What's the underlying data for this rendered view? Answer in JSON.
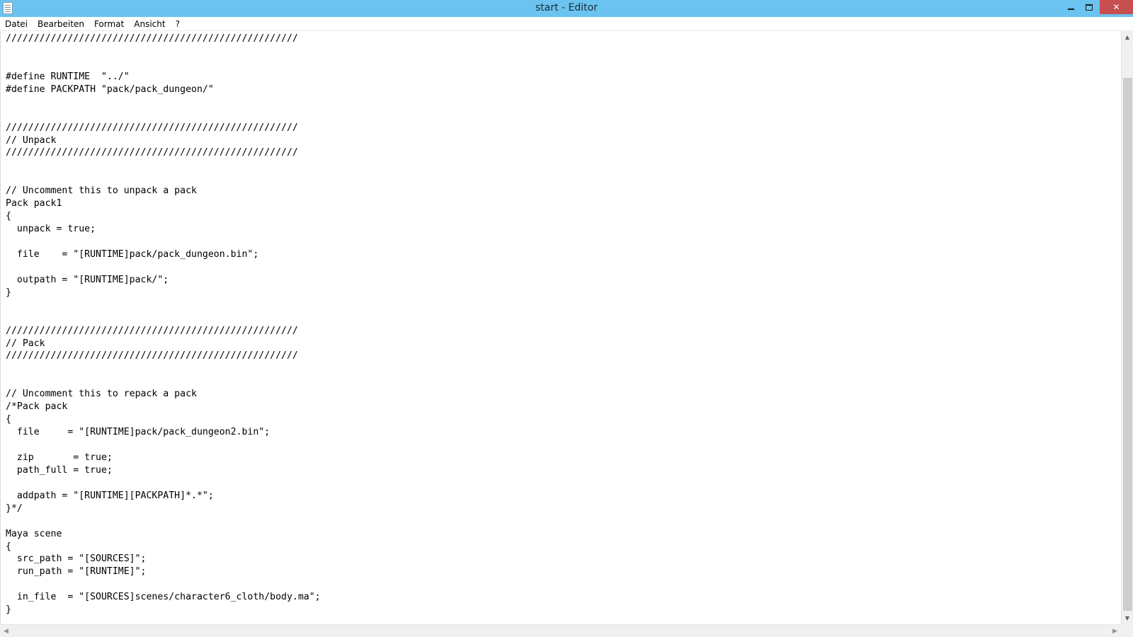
{
  "window": {
    "title": "start - Editor",
    "icon": "notepad-icon",
    "controls": {
      "minimize": "minimize-icon",
      "maximize": "restore-icon",
      "close_glyph": "✕"
    }
  },
  "menu": [
    "Datei",
    "Bearbeiten",
    "Format",
    "Ansicht",
    "?"
  ],
  "editor": {
    "lines": [
      "////////////////////////////////////////////////////",
      "",
      "",
      "#define RUNTIME  \"../\"",
      "#define PACKPATH \"pack/pack_dungeon/\"",
      "",
      "",
      "////////////////////////////////////////////////////",
      "// Unpack",
      "////////////////////////////////////////////////////",
      "",
      "",
      "// Uncomment this to unpack a pack",
      "Pack pack1",
      "{",
      "  unpack = true;",
      "",
      "  file    = \"[RUNTIME]pack/pack_dungeon.bin\";",
      "",
      "  outpath = \"[RUNTIME]pack/\";",
      "}",
      "",
      "",
      "////////////////////////////////////////////////////",
      "// Pack",
      "////////////////////////////////////////////////////",
      "",
      "",
      "// Uncomment this to repack a pack",
      "/*Pack pack",
      "{",
      "  file     = \"[RUNTIME]pack/pack_dungeon2.bin\";",
      "",
      "  zip       = true;",
      "  path_full = true;",
      "",
      "  addpath = \"[RUNTIME][PACKPATH]*.*\";",
      "}*/",
      "",
      "Maya scene",
      "{",
      "  src_path = \"[SOURCES]\";",
      "  run_path = \"[RUNTIME]\";",
      "",
      "  in_file  = \"[SOURCES]scenes/character6_cloth/body.ma\";",
      "}"
    ]
  },
  "scrollbars": {
    "vertical": {
      "up": "▲",
      "down": "▼"
    },
    "horizontal": {
      "left": "◀",
      "right": "▶"
    }
  }
}
